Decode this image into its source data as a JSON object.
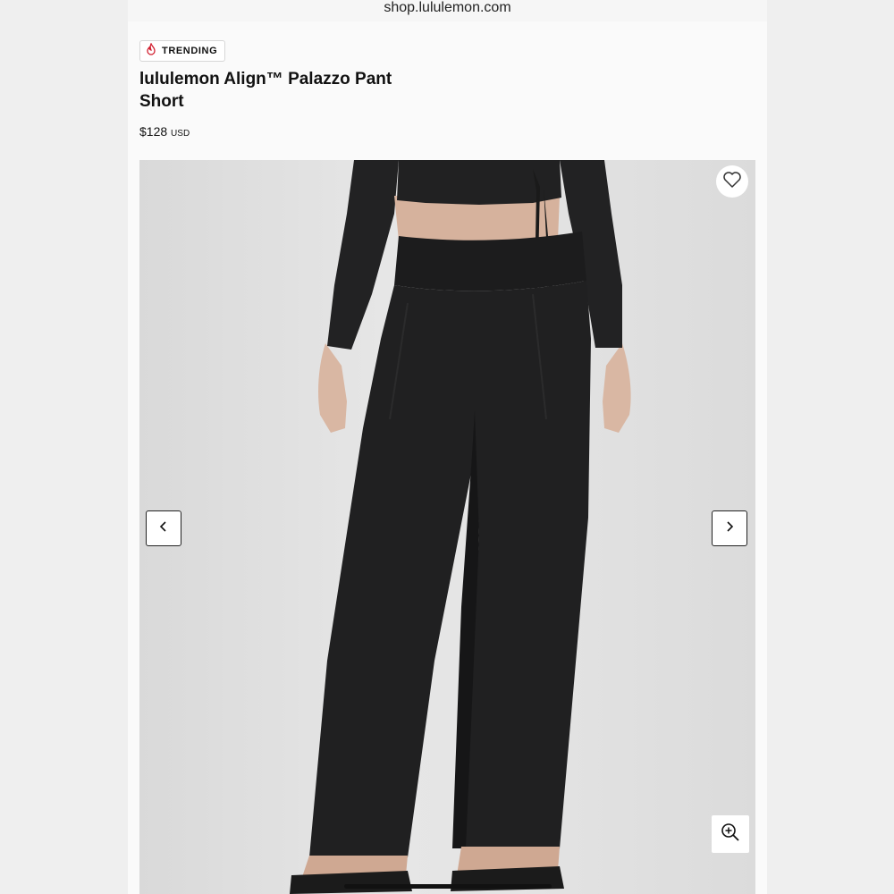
{
  "browser": {
    "url": "shop.lululemon.com"
  },
  "product": {
    "badge": "TRENDING",
    "name": "lululemon Align™ Palazzo Pant Short",
    "price": "$128",
    "currency": "USD"
  },
  "icons": {
    "badge": "flame-icon",
    "favorite": "heart-icon",
    "prev": "chevron-left-icon",
    "next": "chevron-right-icon",
    "zoom": "zoom-in-icon"
  },
  "colors": {
    "flame": "#d22030",
    "text": "#111111",
    "garment": "#1f1f20"
  }
}
